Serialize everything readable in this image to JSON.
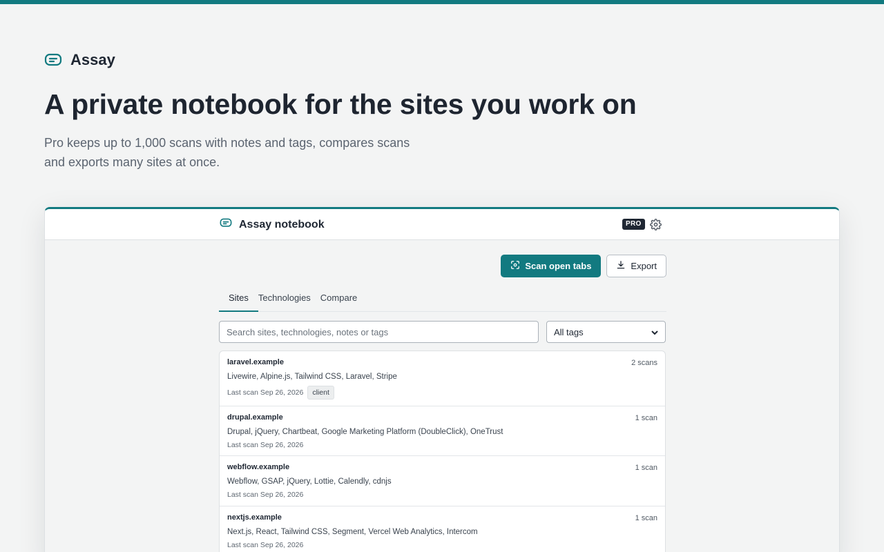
{
  "brand": {
    "name": "Assay",
    "icon": "message-square-icon"
  },
  "hero": {
    "headline": "A private notebook for the sites you work on",
    "subline": "Pro keeps up to 1,000 scans with notes and tags, compares scans and exports many sites at once."
  },
  "app": {
    "title": "Assay notebook",
    "badge": "PRO",
    "settings_icon": "gear-icon",
    "actions": {
      "scan": "Scan open tabs",
      "export": "Export"
    },
    "tabs": [
      "Sites",
      "Technologies",
      "Compare"
    ],
    "active_tab": "Sites",
    "search_placeholder": "Search sites, technologies, notes or tags",
    "tag_filter": "All tags",
    "sites": [
      {
        "domain": "laravel.example",
        "count": "2 scans",
        "tech": "Livewire, Alpine.js, Tailwind CSS, Laravel, Stripe",
        "last_scan": "Last scan Sep 26, 2026",
        "tag": "client"
      },
      {
        "domain": "drupal.example",
        "count": "1 scan",
        "tech": "Drupal, jQuery, Chartbeat, Google Marketing Platform (DoubleClick), OneTrust",
        "last_scan": "Last scan Sep 26, 2026"
      },
      {
        "domain": "webflow.example",
        "count": "1 scan",
        "tech": "Webflow, GSAP, jQuery, Lottie, Calendly, cdnjs",
        "last_scan": "Last scan Sep 26, 2026"
      },
      {
        "domain": "nextjs.example",
        "count": "1 scan",
        "tech": "Next.js, React, Tailwind CSS, Segment, Vercel Web Analytics, Intercom",
        "last_scan": "Last scan Sep 26, 2026"
      }
    ]
  },
  "colors": {
    "accent": "#127a80",
    "background": "#f3f4f4",
    "text": "#1f2733"
  }
}
